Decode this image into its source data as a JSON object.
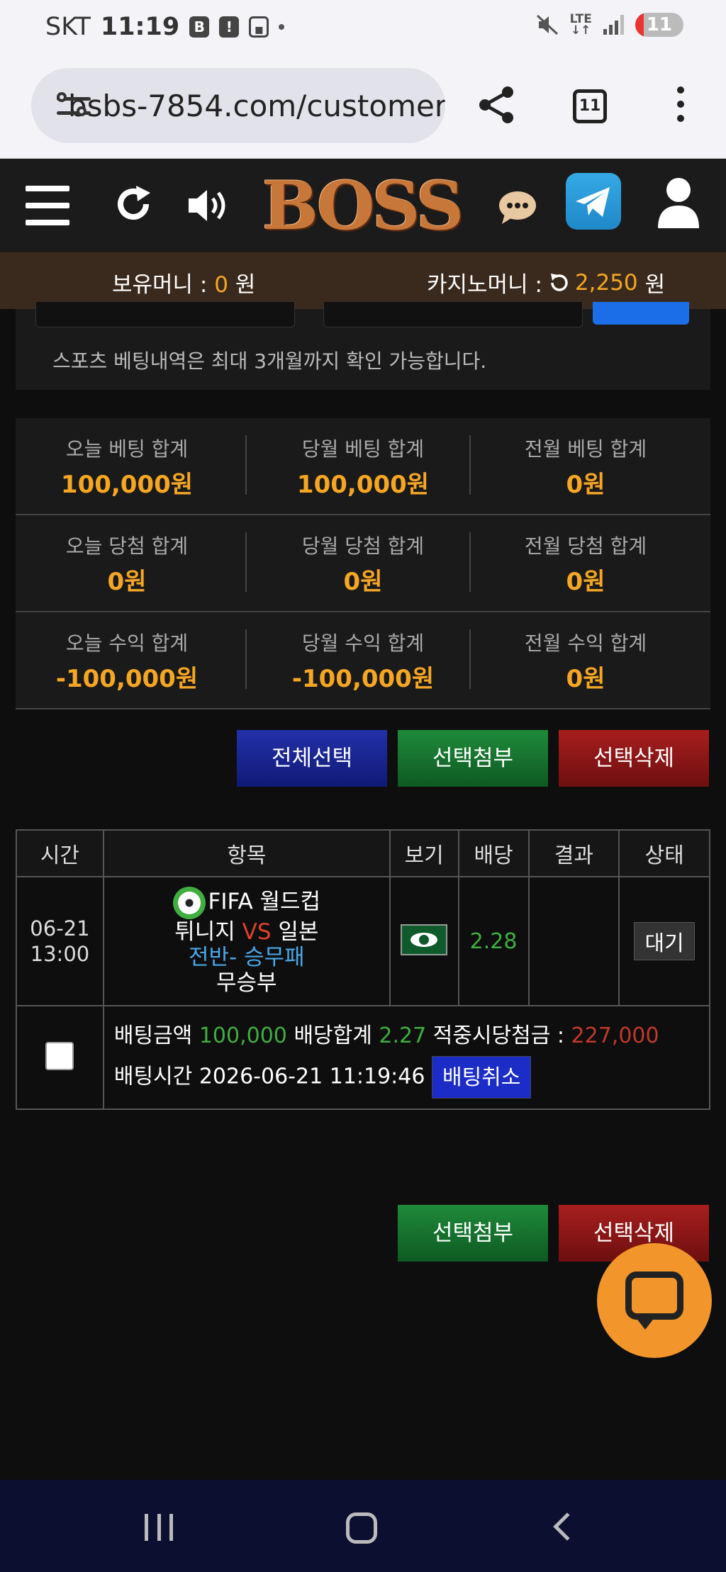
{
  "status_bar": {
    "carrier": "SKT",
    "time": "11:19",
    "network": "LTE",
    "battery": "11"
  },
  "browser": {
    "url": "bsbs-7854.com/customer",
    "tab_count": "11"
  },
  "header": {
    "logo_text": "BOSS"
  },
  "money": {
    "hold_label": "보유머니 :",
    "hold_value": "0",
    "hold_unit": "원",
    "casino_label": "카지노머니 :",
    "casino_value": "2,250",
    "casino_unit": "원"
  },
  "filter": {
    "note": "스포츠 베팅내역은 최대 3개월까지 확인 가능합니다."
  },
  "summary": {
    "rows": [
      [
        {
          "label": "오늘 베팅 합계",
          "value": "100,000원"
        },
        {
          "label": "당월 베팅 합계",
          "value": "100,000원"
        },
        {
          "label": "전월 베팅 합계",
          "value": "0원"
        }
      ],
      [
        {
          "label": "오늘 당첨 합계",
          "value": "0원"
        },
        {
          "label": "당월 당첨 합계",
          "value": "0원"
        },
        {
          "label": "전월 당첨 합계",
          "value": "0원"
        }
      ],
      [
        {
          "label": "오늘 수익 합계",
          "value": "-100,000원"
        },
        {
          "label": "당월 수익 합계",
          "value": "-100,000원"
        },
        {
          "label": "전월 수익 합계",
          "value": "0원"
        }
      ]
    ]
  },
  "actions": {
    "select_all": "전체선택",
    "attach": "선택첨부",
    "delete": "선택삭제"
  },
  "table": {
    "headers": [
      "시간",
      "항목",
      "보기",
      "배당",
      "결과",
      "상태"
    ],
    "bet": {
      "date": "06-21",
      "time": "13:00",
      "league": "FIFA 월드컵",
      "home": "튀니지",
      "vs": "VS",
      "away": "일본",
      "market": "전반- 승무패",
      "pick": "무승부",
      "odds": "2.28",
      "result": "",
      "status": "대기"
    },
    "info": {
      "amount_label": "배팅금액",
      "amount": "100,000",
      "odds_label": "배당합계",
      "odds_total": "2.27",
      "win_label": "적중시당첨금 :",
      "win_amount": "227,000",
      "time_label": "배팅시간",
      "time_value": "2026-06-21 11:19:46",
      "cancel": "배팅취소"
    }
  },
  "colors": {
    "accent_orange": "#f5a623",
    "green": "#3fae3f",
    "red": "#c0392b",
    "blue": "#4aa8e8"
  }
}
